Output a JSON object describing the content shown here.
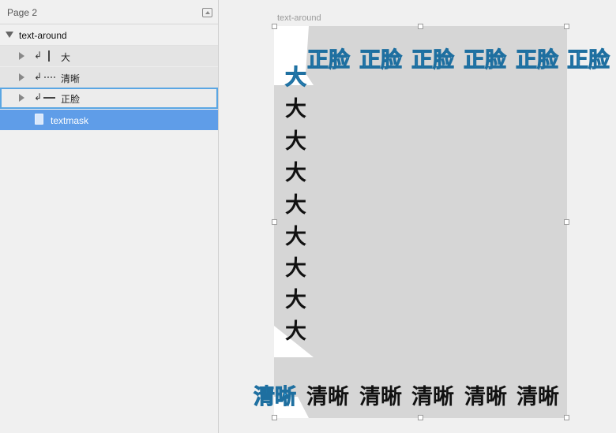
{
  "layers_panel": {
    "page_title": "Page 2",
    "group": {
      "label": "text-around",
      "expanded": true
    },
    "layers": [
      {
        "label": "大",
        "glyph": "vertical-line",
        "masked": true
      },
      {
        "label": "清晰",
        "glyph": "dotted-line",
        "masked": true
      },
      {
        "label": "正脸",
        "glyph": "horizontal-line",
        "masked": true,
        "state": "hovered"
      },
      {
        "label": "textmask",
        "glyph": "mask-shape",
        "state": "selected"
      }
    ]
  },
  "canvas": {
    "artboard_title": "text-around",
    "top_text": [
      "正脸",
      "正脸",
      "正脸",
      "正脸",
      "正脸",
      "正脸"
    ],
    "side_text": [
      "大",
      "大",
      "大",
      "大",
      "大",
      "大",
      "大",
      "大",
      "大"
    ],
    "bottom_text": [
      "清晰",
      "清晰",
      "清晰",
      "清晰",
      "清晰",
      "清晰"
    ]
  },
  "colors": {
    "accent_blue": "#37a9e6",
    "selection_blue": "#5f9de8",
    "hover_border": "#5aa6e3",
    "mask_fill": "#d6d6d6"
  }
}
